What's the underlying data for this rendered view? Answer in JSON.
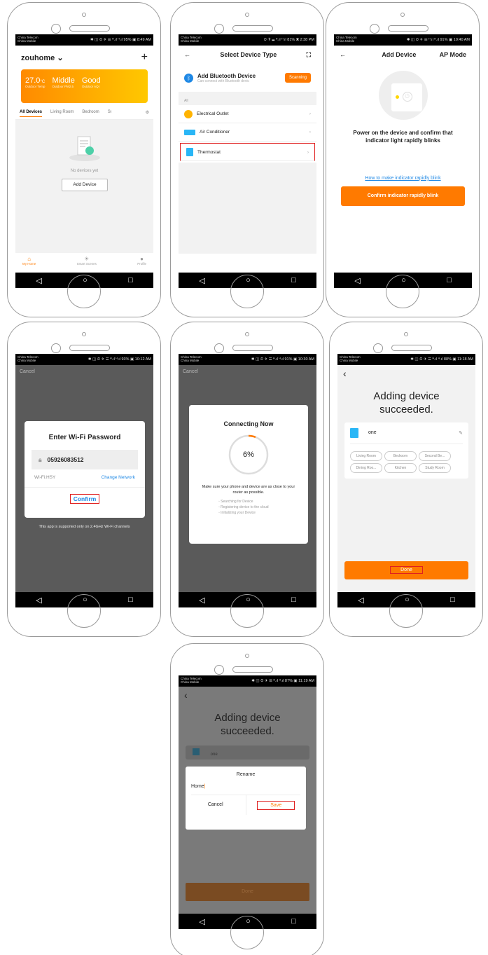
{
  "screen1": {
    "status_left_top": "China Telecom",
    "status_left_bottom": "China Mobile",
    "status_right": "✱ ◫ ⏲ ✈ ☰ ᴴ.ıl ᴴ.ıl 95% ▣ 8:49 AM",
    "home_name": "zouhome ⌄",
    "plus": "+",
    "temp": "27.0",
    "temp_unit": "°C",
    "temp_label": "Outdoor Temp",
    "pm_value": "Middle",
    "pm_label": "Outdoor PM2.5",
    "aqi_value": "Good",
    "aqi_label": "Outdoor AQI",
    "tabs": [
      "All Devices",
      "Living Room",
      "Bedroom",
      "Sı"
    ],
    "empty_text": "No devices yet",
    "add_device": "Add Device",
    "nav": [
      "My Home",
      "Smart Scenes",
      "Profile"
    ]
  },
  "screen2": {
    "status_right": "⏲ ✈ ☰ ᴴ.ıl ᴴ.ıl 81% ▣ 2:38 PM",
    "title": "Select Device Type",
    "bt_title": "Add Bluetooth Device",
    "bt_sub": "Can connect with Bluetooth devic",
    "scanning": "Scanning",
    "section": "All",
    "devices": [
      "Electrical Outlet",
      "Air Conditioner",
      "Thermostat"
    ]
  },
  "screen3": {
    "status_right": "✱ ◫ ⏲ ✈ ☰ ᴴ.ıl ᴴ.ıl 91% ▣ 10:40 AM",
    "title": "Add Device",
    "mode": "AP Mode",
    "instruction": "Power on the device and confirm that indicator light rapidly blinks",
    "link": "How to make indicator rapidly blink",
    "button": "Confirm indicator rapidly blink"
  },
  "screen4": {
    "status_right": "✱ ◫ ⏲ ✈ ☰ ᴴ.ıl ᴴ.ıl 93% ▣ 10:12 AM",
    "cancel": "Cancel",
    "dialog_title": "Enter Wi-Fi Password",
    "password": "05926083512",
    "wifi_label": "Wi-Fi:HSY",
    "change_network": "Change Network",
    "confirm": "Confirm",
    "note": "This app is supported only on 2.4GHz Wi-Fi channels"
  },
  "screen5": {
    "status_right": "✱ ◫ ⏲ ✈ ☰ ᴴ.ıl ᴴ.ıl 91% ▣ 10:30 AM",
    "cancel": "Cancel",
    "title": "Connecting Now",
    "percent": "6%",
    "progress": 0.06,
    "note": "Make sure your phone and device are as close to your router as possible.",
    "steps": [
      "Searching for Device",
      "Registering device to the cloud",
      "Initializing your Device"
    ]
  },
  "screen6": {
    "status_right": "✱ ◫ ⏲ ✈ ☰ ᴴ.ıl ᴴ.ıl 88% ▣ 11:18 AM",
    "title": "Adding device succeeded.",
    "device_name": "one",
    "rooms": [
      "Living Room",
      "Bedroom",
      "Second Be...",
      "Dining Roo...",
      "Kitchen",
      "Study Room"
    ],
    "done": "Done"
  },
  "screen7": {
    "status_right": "✱ ◫ ⏲ ✈ ☰ ᴴ.ıl ᴴ.ıl 87% ▣ 11:19 AM",
    "title": "Adding device succeeded.",
    "device_name": "one",
    "dialog_title": "Rename",
    "input_value": "Home",
    "cancel": "Cancel",
    "save": "Save",
    "done": "Done"
  }
}
